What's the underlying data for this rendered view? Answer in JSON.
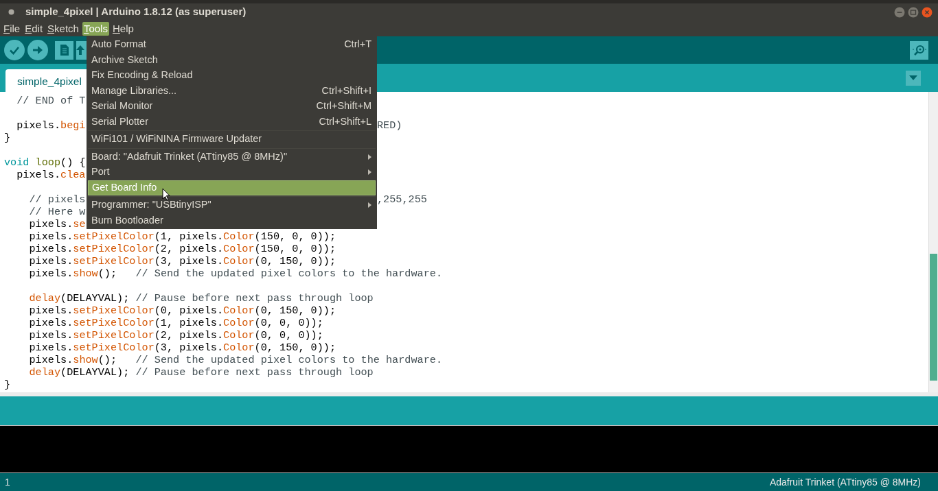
{
  "window": {
    "title": "simple_4pixel | Arduino 1.8.12 (as superuser)"
  },
  "menubar": [
    {
      "label": "File",
      "selected": false
    },
    {
      "label": "Edit",
      "selected": false
    },
    {
      "label": "Sketch",
      "selected": false
    },
    {
      "label": "Tools",
      "selected": true
    },
    {
      "label": "Help",
      "selected": false
    }
  ],
  "tabs": [
    {
      "label": "simple_4pixel",
      "selected": true
    }
  ],
  "editor": {
    "lines": [
      {
        "tokens": [
          {
            "kind": "comment",
            "text": "  // END of T"
          }
        ]
      },
      {
        "kind": "blank"
      },
      {
        "tokens": [
          {
            "kind": "plain",
            "text": "  pixels."
          },
          {
            "kind": "call",
            "text": "begi"
          }
        ],
        "after_menu": [
          {
            "kind": "comment",
            "text": "RED)"
          }
        ]
      },
      {
        "tokens": [
          {
            "kind": "plain",
            "text": "}"
          }
        ]
      },
      {
        "kind": "blank"
      },
      {
        "tokens": [
          {
            "kind": "keyword",
            "text": "void "
          },
          {
            "kind": "function",
            "text": "loop"
          },
          {
            "kind": "plain",
            "text": "() {"
          }
        ]
      },
      {
        "tokens": [
          {
            "kind": "plain",
            "text": "  pixels."
          },
          {
            "kind": "call",
            "text": "clea"
          }
        ]
      },
      {
        "kind": "blank"
      },
      {
        "tokens": [
          {
            "kind": "comment",
            "text": "    // pixels"
          }
        ],
        "after_menu": [
          {
            "kind": "comment",
            "text": ",255,255"
          }
        ]
      },
      {
        "tokens": [
          {
            "kind": "comment",
            "text": "    // Here w"
          }
        ]
      },
      {
        "tokens": [
          {
            "kind": "plain",
            "text": "    pixels."
          },
          {
            "kind": "call",
            "text": "se"
          }
        ]
      },
      {
        "tokens": [
          {
            "kind": "plain",
            "text": "    pixels."
          },
          {
            "kind": "call",
            "text": "setPixelColor"
          },
          {
            "kind": "plain",
            "text": "(1, pixels."
          },
          {
            "kind": "call",
            "text": "Color"
          },
          {
            "kind": "plain",
            "text": "(150, 0, 0));"
          }
        ]
      },
      {
        "tokens": [
          {
            "kind": "plain",
            "text": "    pixels."
          },
          {
            "kind": "call",
            "text": "setPixelColor"
          },
          {
            "kind": "plain",
            "text": "(2, pixels."
          },
          {
            "kind": "call",
            "text": "Color"
          },
          {
            "kind": "plain",
            "text": "(150, 0, 0));"
          }
        ]
      },
      {
        "tokens": [
          {
            "kind": "plain",
            "text": "    pixels."
          },
          {
            "kind": "call",
            "text": "setPixelColor"
          },
          {
            "kind": "plain",
            "text": "(3, pixels."
          },
          {
            "kind": "call",
            "text": "Color"
          },
          {
            "kind": "plain",
            "text": "(0, 150, 0));"
          }
        ]
      },
      {
        "tokens": [
          {
            "kind": "plain",
            "text": "    pixels."
          },
          {
            "kind": "call",
            "text": "show"
          },
          {
            "kind": "plain",
            "text": "();   "
          },
          {
            "kind": "comment",
            "text": "// Send the updated pixel colors to the hardware."
          }
        ]
      },
      {
        "kind": "blank"
      },
      {
        "tokens": [
          {
            "kind": "call",
            "text": "    delay"
          },
          {
            "kind": "plain",
            "text": "(DELAYVAL); "
          },
          {
            "kind": "comment",
            "text": "// Pause before next pass through loop"
          }
        ]
      },
      {
        "tokens": [
          {
            "kind": "plain",
            "text": "    pixels."
          },
          {
            "kind": "call",
            "text": "setPixelColor"
          },
          {
            "kind": "plain",
            "text": "(0, pixels."
          },
          {
            "kind": "call",
            "text": "Color"
          },
          {
            "kind": "plain",
            "text": "(0, 150, 0));"
          }
        ]
      },
      {
        "tokens": [
          {
            "kind": "plain",
            "text": "    pixels."
          },
          {
            "kind": "call",
            "text": "setPixelColor"
          },
          {
            "kind": "plain",
            "text": "(1, pixels."
          },
          {
            "kind": "call",
            "text": "Color"
          },
          {
            "kind": "plain",
            "text": "(0, 0, 0));"
          }
        ]
      },
      {
        "tokens": [
          {
            "kind": "plain",
            "text": "    pixels."
          },
          {
            "kind": "call",
            "text": "setPixelColor"
          },
          {
            "kind": "plain",
            "text": "(2, pixels."
          },
          {
            "kind": "call",
            "text": "Color"
          },
          {
            "kind": "plain",
            "text": "(0, 0, 0));"
          }
        ]
      },
      {
        "tokens": [
          {
            "kind": "plain",
            "text": "    pixels."
          },
          {
            "kind": "call",
            "text": "setPixelColor"
          },
          {
            "kind": "plain",
            "text": "(3, pixels."
          },
          {
            "kind": "call",
            "text": "Color"
          },
          {
            "kind": "plain",
            "text": "(0, 150, 0));"
          }
        ]
      },
      {
        "tokens": [
          {
            "kind": "plain",
            "text": "    pixels."
          },
          {
            "kind": "call",
            "text": "show"
          },
          {
            "kind": "plain",
            "text": "();   "
          },
          {
            "kind": "comment",
            "text": "// Send the updated pixel colors to the hardware."
          }
        ]
      },
      {
        "tokens": [
          {
            "kind": "call",
            "text": "    delay"
          },
          {
            "kind": "plain",
            "text": "(DELAYVAL); "
          },
          {
            "kind": "comment",
            "text": "// Pause before next pass through loop"
          }
        ]
      },
      {
        "tokens": [
          {
            "kind": "plain",
            "text": "}"
          }
        ]
      }
    ]
  },
  "tools_menu": {
    "items": [
      {
        "kind": "item",
        "label": "Auto Format",
        "shortcut": "Ctrl+T",
        "submenu": false,
        "selected": false
      },
      {
        "kind": "item",
        "label": "Archive Sketch",
        "submenu": false,
        "selected": false
      },
      {
        "kind": "item",
        "label": "Fix Encoding & Reload",
        "submenu": false,
        "selected": false
      },
      {
        "kind": "item",
        "label": "Manage Libraries...",
        "shortcut": "Ctrl+Shift+I",
        "submenu": false,
        "selected": false
      },
      {
        "kind": "item",
        "label": "Serial Monitor",
        "shortcut": "Ctrl+Shift+M",
        "submenu": false,
        "selected": false
      },
      {
        "kind": "item",
        "label": "Serial Plotter",
        "shortcut": "Ctrl+Shift+L",
        "submenu": false,
        "selected": false
      },
      {
        "kind": "separator"
      },
      {
        "kind": "item",
        "label": "WiFi101 / WiFiNINA Firmware Updater",
        "submenu": false,
        "selected": false
      },
      {
        "kind": "separator"
      },
      {
        "kind": "item",
        "label": "Board: \"Adafruit Trinket (ATtiny85 @ 8MHz)\"",
        "submenu": true,
        "selected": false
      },
      {
        "kind": "item",
        "label": "Port",
        "submenu": true,
        "selected": false
      },
      {
        "kind": "item",
        "label": "Get Board Info",
        "submenu": false,
        "selected": true
      },
      {
        "kind": "separator"
      },
      {
        "kind": "item",
        "label": "Programmer: \"USBtinyISP\"",
        "submenu": true,
        "selected": false
      },
      {
        "kind": "item",
        "label": "Burn Bootloader",
        "submenu": false,
        "selected": false
      }
    ]
  },
  "status_bar": {
    "line": "1",
    "board": "Adafruit Trinket (ATtiny85 @ 8MHz)"
  }
}
